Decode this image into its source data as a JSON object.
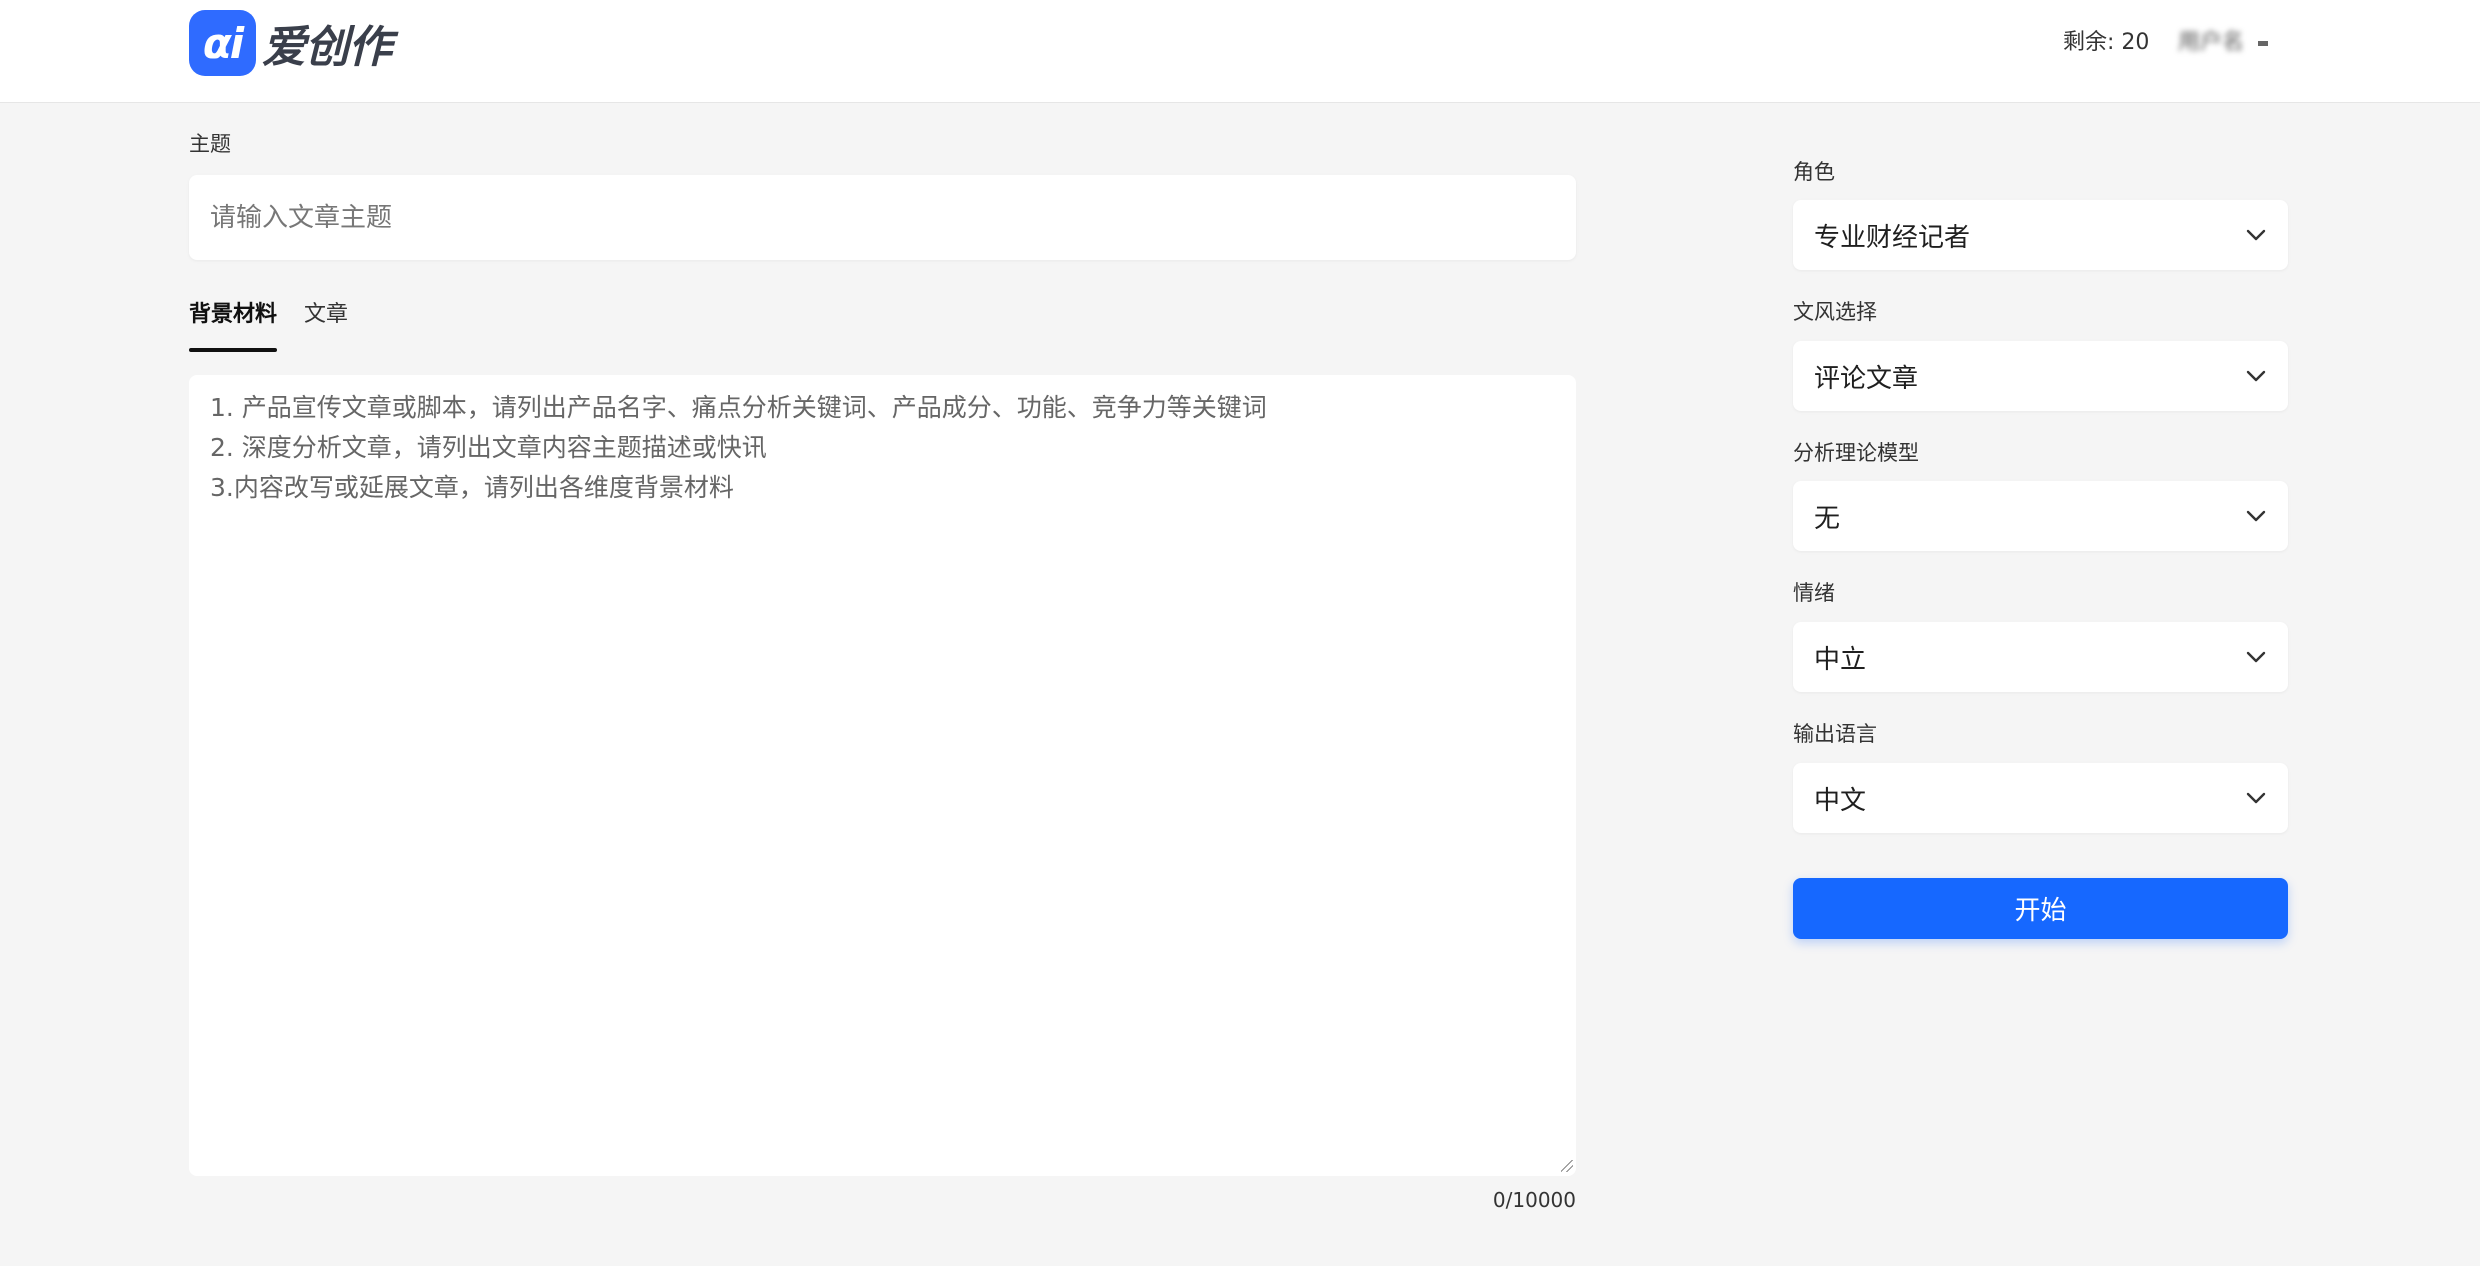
{
  "header": {
    "logo_mark": "αi",
    "logo_text": "爱创作",
    "remaining": "剩余: 20",
    "user_name": "用户名"
  },
  "topic": {
    "label": "主题",
    "placeholder": "请输入文章主题",
    "value": ""
  },
  "tabs": [
    {
      "label": "背景材料",
      "active": true
    },
    {
      "label": "文章",
      "active": false
    }
  ],
  "material": {
    "placeholder": "1. 产品宣传文章或脚本，请列出产品名字、痛点分析关键词、产品成分、功能、竞争力等关键词\n2. 深度分析文章，请列出文章内容主题描述或快讯\n3.内容改写或延展文章，请列出各维度背景材料",
    "value": "",
    "counter": "0/10000"
  },
  "settings": {
    "role": {
      "label": "角色",
      "value": "专业财经记者"
    },
    "style": {
      "label": "文风选择",
      "value": "评论文章"
    },
    "model": {
      "label": "分析理论模型",
      "value": "无"
    },
    "emotion": {
      "label": "情绪",
      "value": "中立"
    },
    "language": {
      "label": "输出语言",
      "value": "中文"
    }
  },
  "start_button": "开始",
  "colors": {
    "accent": "#1668ff",
    "logo_badge": "#2f6bff",
    "background": "#f5f5f5"
  }
}
